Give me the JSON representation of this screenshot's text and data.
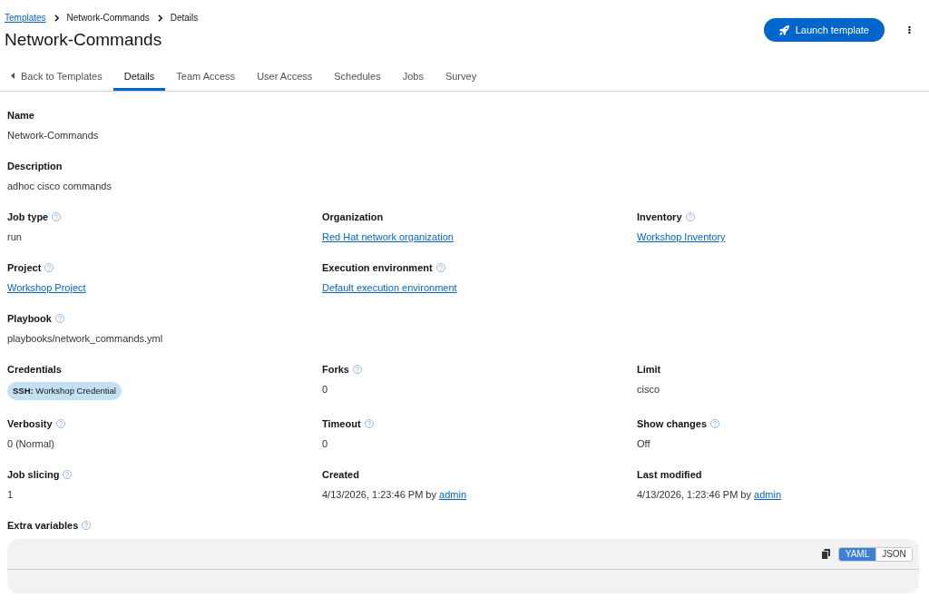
{
  "breadcrumbs": [
    {
      "label": "Templates",
      "kind": "link"
    },
    {
      "label": "Network-Commands",
      "kind": "text"
    },
    {
      "label": "Details",
      "kind": "text"
    }
  ],
  "title": "Network-Commands",
  "launch_button": {
    "label": "Launch template"
  },
  "tabs": [
    {
      "label": "Back to Templates",
      "kind": "back",
      "selected": false
    },
    {
      "label": "Details",
      "kind": "tab",
      "selected": true
    },
    {
      "label": "Team Access",
      "kind": "tab",
      "selected": false
    },
    {
      "label": "User Access",
      "kind": "tab",
      "selected": false
    },
    {
      "label": "Schedules",
      "kind": "tab",
      "selected": false
    },
    {
      "label": "Jobs",
      "kind": "tab",
      "selected": false
    },
    {
      "label": "Survey",
      "kind": "tab",
      "selected": false
    }
  ],
  "detail_rows": [
    [
      {
        "label": "Name",
        "help": false,
        "kind": "text",
        "value": "Network-Commands"
      }
    ],
    [
      {
        "label": "Description",
        "help": false,
        "kind": "text",
        "value": "adhoc cisco commands"
      }
    ],
    [
      {
        "label": "Job type",
        "help": true,
        "kind": "text",
        "value": "run"
      },
      {
        "label": "Organization",
        "help": false,
        "kind": "link",
        "value": "Red Hat network organization"
      },
      {
        "label": "Inventory",
        "help": true,
        "kind": "link",
        "value": "Workshop Inventory"
      }
    ],
    [
      {
        "label": "Project",
        "help": true,
        "kind": "link",
        "value": "Workshop Project"
      },
      {
        "label": "Execution environment",
        "help": true,
        "kind": "link",
        "value": "Default execution environment"
      }
    ],
    [
      {
        "label": "Playbook",
        "help": true,
        "kind": "text",
        "value": "playbooks/network_commands.yml"
      }
    ],
    [
      {
        "label": "Credentials",
        "help": false,
        "kind": "chip",
        "value": "**SSH:** Workshop Credential"
      },
      {
        "label": "Forks",
        "help": true,
        "kind": "text",
        "value": "0"
      },
      {
        "label": "Limit",
        "help": false,
        "kind": "text",
        "value": "cisco"
      }
    ],
    [
      {
        "label": "Verbosity",
        "help": true,
        "kind": "text",
        "value": "0 (Normal)"
      },
      {
        "label": "Timeout",
        "help": true,
        "kind": "text",
        "value": "0"
      },
      {
        "label": "Show changes",
        "help": true,
        "kind": "text",
        "value": "Off"
      }
    ],
    [
      {
        "label": "Job slicing",
        "help": true,
        "kind": "text",
        "value": "1"
      },
      {
        "label": "Created",
        "help": false,
        "kind": "byline",
        "value": "4/13/2026, 1:23:46 PM by",
        "link": "admin"
      },
      {
        "label": "Last modified",
        "help": false,
        "kind": "byline",
        "value": "4/13/2026, 1:23:46 PM by",
        "link": "admin"
      }
    ]
  ],
  "extra_variables": {
    "label": "Extra variables",
    "help": true,
    "modes": [
      {
        "label": "YAML",
        "selected": true
      },
      {
        "label": "JSON",
        "selected": false
      }
    ]
  }
}
